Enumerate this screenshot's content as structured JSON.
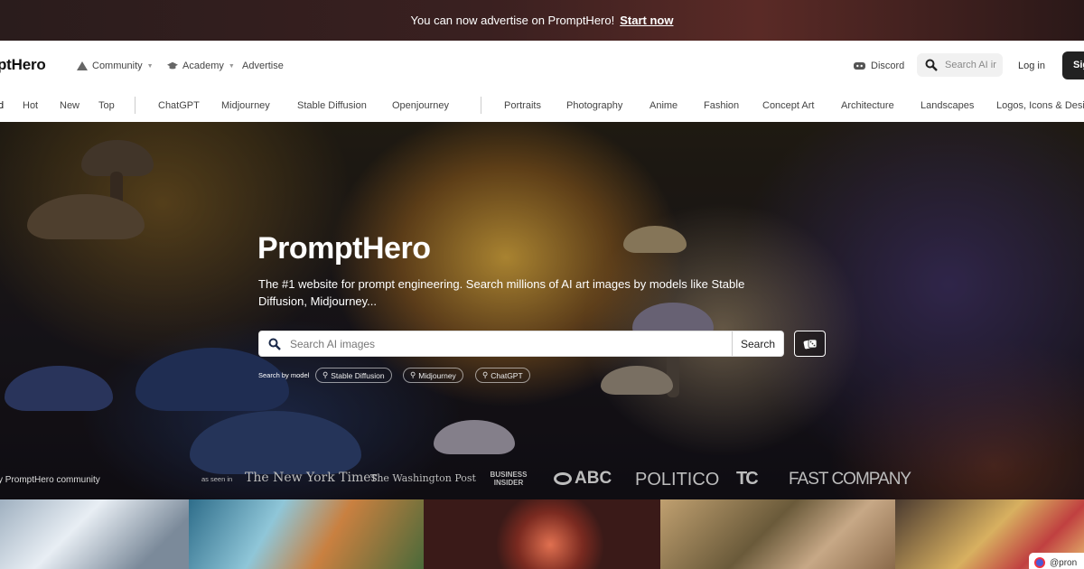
{
  "announcement": {
    "text": "You can now advertise on PromptHero!",
    "cta": "Start now"
  },
  "header": {
    "logo": "ptHero",
    "nav": [
      {
        "label": "Community",
        "icon": "community-icon"
      },
      {
        "label": "Academy",
        "icon": "graduation-cap-icon"
      },
      {
        "label": "Advertise"
      }
    ],
    "discord_label": "Discord",
    "search_placeholder": "Search AI ir",
    "login_label": "Log in",
    "signup_label": "Sig"
  },
  "categories": {
    "sort": [
      "d",
      "Hot",
      "New",
      "Top"
    ],
    "models": [
      "ChatGPT",
      "Midjourney",
      "Stable Diffusion",
      "Openjourney"
    ],
    "topics": [
      "Portraits",
      "Photography",
      "Anime",
      "Fashion",
      "Concept Art",
      "Architecture",
      "Landscapes",
      "Logos, Icons & Desig"
    ]
  },
  "hero": {
    "title": "PromptHero",
    "subtitle": "The #1 website for prompt engineering. Search millions of AI art images by models like Stable Diffusion, Midjourney...",
    "search_placeholder": "Search AI images",
    "search_button": "Search",
    "search_by_model_label": "Search by model",
    "model_chips": [
      "Stable Diffusion",
      "Midjourney",
      "ChatGPT"
    ],
    "community_label": "y PromptHero community",
    "as_seen_in": "as seen in",
    "press": [
      "The New York Times",
      "The Washington Post",
      "BUSINESS INSIDER",
      "ABC",
      "POLITICO",
      "TC",
      "FAST COMPANY"
    ]
  },
  "badge": {
    "label": "@pron"
  },
  "colors": {
    "accent_dark": "#222222",
    "announcement_bg": "#3a2020"
  }
}
